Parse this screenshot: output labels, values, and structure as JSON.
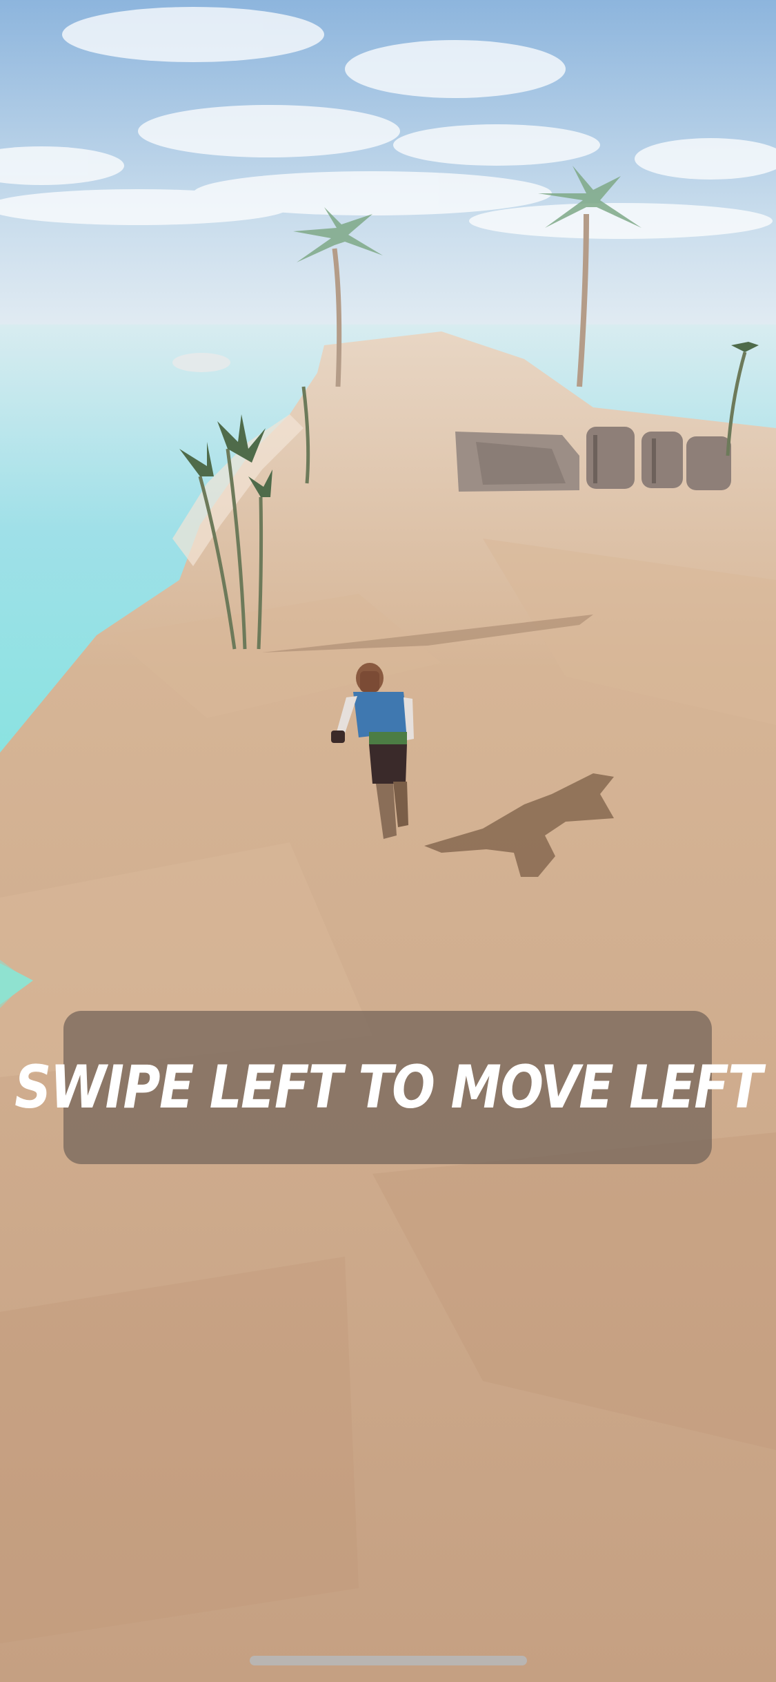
{
  "tutorial": {
    "instruction": "SWIPE LEFT TO MOVE LEFT"
  },
  "colors": {
    "sky_top": "#8fb6dc",
    "sky_horizon": "#e6eef3",
    "sea": "#7fe3e0",
    "sand": "#c9a485",
    "banner": "#78685c",
    "text": "#ffffff"
  }
}
